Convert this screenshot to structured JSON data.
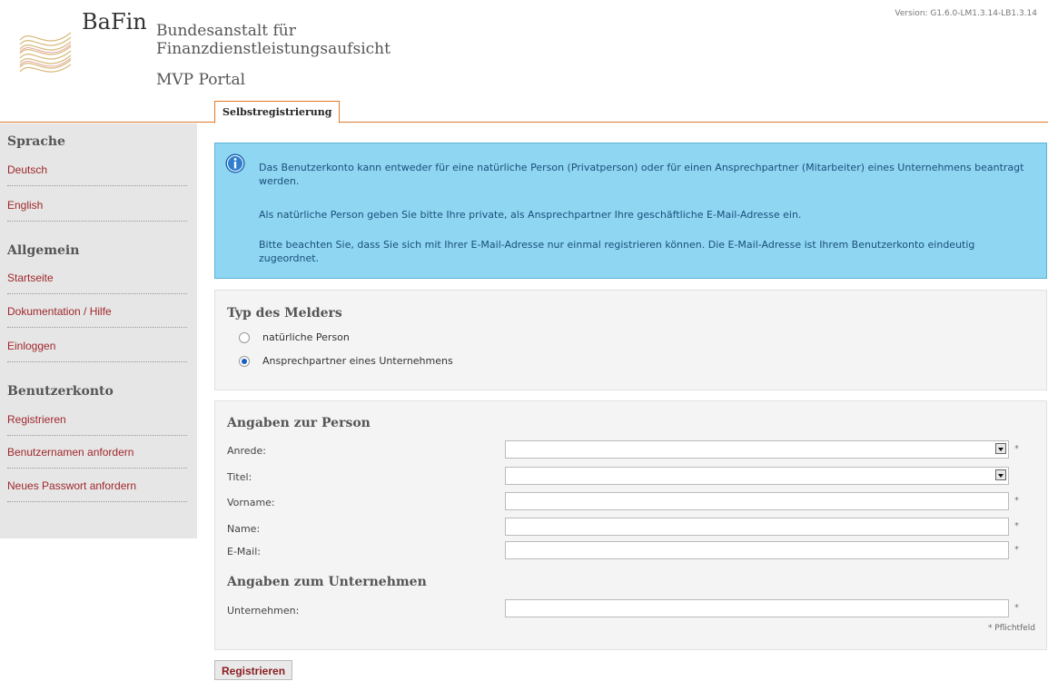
{
  "header": {
    "brand": "BaFin",
    "org_line1": "Bundesanstalt für",
    "org_line2": "Finanzdienstleistungsaufsicht",
    "portal": "MVP Portal",
    "version": "Version: G1.6.0-LM1.3.14-LB1.3.14",
    "logo_icon": "bafin-wave-logo"
  },
  "tabs": [
    {
      "label": "Selbstregistrierung",
      "active": true
    }
  ],
  "sidebar": {
    "sections": [
      {
        "title": "Sprache",
        "items": [
          "Deutsch",
          "English"
        ]
      },
      {
        "title": "Allgemein",
        "items": [
          "Startseite",
          "Dokumentation / Hilfe",
          "Einloggen"
        ]
      },
      {
        "title": "Benutzerkonto",
        "items": [
          "Registrieren",
          "Benutzernamen anfordern",
          "Neues Passwort anfordern"
        ]
      }
    ]
  },
  "info": {
    "icon": "info-icon",
    "p1": "Das Benutzerkonto kann entweder für eine natürliche Person (Privatperson) oder für einen Ansprechpartner (Mitarbeiter) eines Unternehmens beantragt werden.",
    "p2": "Als natürliche Person geben Sie bitte Ihre private, als Ansprechpartner Ihre geschäftliche E-Mail-Adresse ein.",
    "p3": "Bitte beachten Sie, dass Sie sich mit Ihrer E-Mail-Adresse nur einmal registrieren können. Die E-Mail-Adresse ist Ihrem Benutzerkonto eindeutig zugeordnet."
  },
  "melder": {
    "title": "Typ des Melders",
    "options": [
      {
        "label": "natürliche Person",
        "checked": false
      },
      {
        "label": "Ansprechpartner eines Unternehmens",
        "checked": true
      }
    ]
  },
  "person": {
    "title": "Angaben zur Person",
    "fields": {
      "anrede": {
        "label": "Anrede:",
        "value": "",
        "required": "*"
      },
      "titel": {
        "label": "Titel:",
        "value": ""
      },
      "vorname": {
        "label": "Vorname:",
        "value": "",
        "required": "*"
      },
      "name": {
        "label": "Name:",
        "value": "",
        "required": "*"
      },
      "email": {
        "label": "E-Mail:",
        "value": "",
        "required": "*"
      }
    }
  },
  "company": {
    "title": "Angaben zum Unternehmen",
    "field": {
      "label": "Unternehmen:",
      "value": "",
      "required": "*"
    },
    "pflicht": "* Pflichtfeld"
  },
  "submit_label": "Registrieren",
  "colors": {
    "accent": "#e07a2a",
    "link": "#a0282d",
    "info_bg": "#8fd6f2"
  }
}
